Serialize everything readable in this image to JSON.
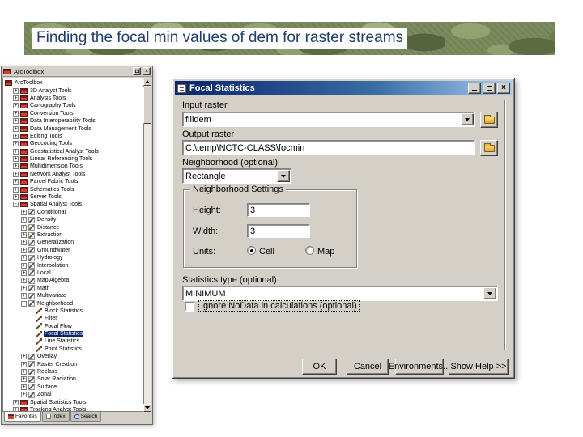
{
  "slide": {
    "title": "Finding the focal min values of dem for raster streams"
  },
  "icons": {
    "close": "×",
    "window_title": "focal-statistics-window"
  },
  "arctoolbox": {
    "title": "ArcToolbox",
    "tabs": [
      {
        "label": "Favorites"
      },
      {
        "label": "Index"
      },
      {
        "label": "Search"
      }
    ],
    "tree": {
      "items": [
        {
          "label": "ArcToolbox",
          "level": 0,
          "icon": "toolbox",
          "exp": ""
        },
        {
          "label": "3D Analyst Tools",
          "level": 1,
          "icon": "toolbox",
          "exp": "+"
        },
        {
          "label": "Analysis Tools",
          "level": 1,
          "icon": "toolbox",
          "exp": "+"
        },
        {
          "label": "Cartography Tools",
          "level": 1,
          "icon": "toolbox",
          "exp": "+"
        },
        {
          "label": "Conversion Tools",
          "level": 1,
          "icon": "toolbox",
          "exp": "+"
        },
        {
          "label": "Data Interoperability Tools",
          "level": 1,
          "icon": "toolbox",
          "exp": "+"
        },
        {
          "label": "Data Management Tools",
          "level": 1,
          "icon": "toolbox",
          "exp": "+"
        },
        {
          "label": "Editing Tools",
          "level": 1,
          "icon": "toolbox",
          "exp": "+"
        },
        {
          "label": "Geocoding Tools",
          "level": 1,
          "icon": "toolbox",
          "exp": "+"
        },
        {
          "label": "Geostatistical Analyst Tools",
          "level": 1,
          "icon": "toolbox",
          "exp": "+"
        },
        {
          "label": "Linear Referencing Tools",
          "level": 1,
          "icon": "toolbox",
          "exp": "+"
        },
        {
          "label": "Multidimension Tools",
          "level": 1,
          "icon": "toolbox",
          "exp": "+"
        },
        {
          "label": "Network Analyst Tools",
          "level": 1,
          "icon": "toolbox",
          "exp": "+"
        },
        {
          "label": "Parcel Fabric Tools",
          "level": 1,
          "icon": "toolbox",
          "exp": "+"
        },
        {
          "label": "Schematics Tools",
          "level": 1,
          "icon": "toolbox",
          "exp": "+"
        },
        {
          "label": "Server Tools",
          "level": 1,
          "icon": "toolbox",
          "exp": "+"
        },
        {
          "label": "Spatial Analyst Tools",
          "level": 1,
          "icon": "toolbox",
          "exp": "-"
        },
        {
          "label": "Conditional",
          "level": 2,
          "icon": "toolset",
          "exp": "+"
        },
        {
          "label": "Density",
          "level": 2,
          "icon": "toolset",
          "exp": "+"
        },
        {
          "label": "Distance",
          "level": 2,
          "icon": "toolset",
          "exp": "+"
        },
        {
          "label": "Extraction",
          "level": 2,
          "icon": "toolset",
          "exp": "+"
        },
        {
          "label": "Generalization",
          "level": 2,
          "icon": "toolset",
          "exp": "+"
        },
        {
          "label": "Groundwater",
          "level": 2,
          "icon": "toolset",
          "exp": "+"
        },
        {
          "label": "Hydrology",
          "level": 2,
          "icon": "toolset",
          "exp": "+"
        },
        {
          "label": "Interpolation",
          "level": 2,
          "icon": "toolset",
          "exp": "+"
        },
        {
          "label": "Local",
          "level": 2,
          "icon": "toolset",
          "exp": "+"
        },
        {
          "label": "Map Algebra",
          "level": 2,
          "icon": "toolset",
          "exp": "+"
        },
        {
          "label": "Math",
          "level": 2,
          "icon": "toolset",
          "exp": "+"
        },
        {
          "label": "Multivariate",
          "level": 2,
          "icon": "toolset",
          "exp": "+"
        },
        {
          "label": "Neighborhood",
          "level": 2,
          "icon": "toolset",
          "exp": "-"
        },
        {
          "label": "Block Statistics",
          "level": 3,
          "icon": "tool",
          "exp": ""
        },
        {
          "label": "Filter",
          "level": 3,
          "icon": "tool",
          "exp": ""
        },
        {
          "label": "Focal Flow",
          "level": 3,
          "icon": "tool",
          "exp": ""
        },
        {
          "label": "Focal Statistics",
          "level": 3,
          "icon": "tool",
          "exp": "",
          "selected": true
        },
        {
          "label": "Line Statistics",
          "level": 3,
          "icon": "tool",
          "exp": ""
        },
        {
          "label": "Point Statistics",
          "level": 3,
          "icon": "tool",
          "exp": ""
        },
        {
          "label": "Overlay",
          "level": 2,
          "icon": "toolset",
          "exp": "+"
        },
        {
          "label": "Raster Creation",
          "level": 2,
          "icon": "toolset",
          "exp": "+"
        },
        {
          "label": "Reclass",
          "level": 2,
          "icon": "toolset",
          "exp": "+"
        },
        {
          "label": "Solar Radiation",
          "level": 2,
          "icon": "toolset",
          "exp": "+"
        },
        {
          "label": "Surface",
          "level": 2,
          "icon": "toolset",
          "exp": "+"
        },
        {
          "label": "Zonal",
          "level": 2,
          "icon": "toolset",
          "exp": "+"
        },
        {
          "label": "Spatial Statistics Tools",
          "level": 1,
          "icon": "toolbox",
          "exp": "+"
        },
        {
          "label": "Tracking Analyst Tools",
          "level": 1,
          "icon": "toolbox",
          "exp": "+"
        }
      ]
    }
  },
  "dialog": {
    "title": "Focal Statistics",
    "input_raster": {
      "label": "Input raster",
      "value": "filldem"
    },
    "output_raster": {
      "label": "Output raster",
      "value": "C:\\temp\\NCTC-CLASS\\focmin"
    },
    "neighborhood": {
      "label": "Neighborhood (optional)",
      "value": "Rectangle"
    },
    "settings": {
      "legend": "Neighborhood Settings",
      "height": {
        "label": "Height:",
        "value": "3"
      },
      "width": {
        "label": "Width:",
        "value": "3"
      },
      "units": {
        "label": "Units:",
        "cell": "Cell",
        "map": "Map",
        "selected": "Cell"
      }
    },
    "statistics": {
      "label": "Statistics type (optional)",
      "value": "MINIMUM"
    },
    "ignore_nodata": {
      "label": "Ignore NoData in calculations (optional)",
      "checked": false
    },
    "buttons": {
      "ok": "OK",
      "cancel": "Cancel",
      "environments": "Environments...",
      "help": "Show Help >>"
    }
  }
}
